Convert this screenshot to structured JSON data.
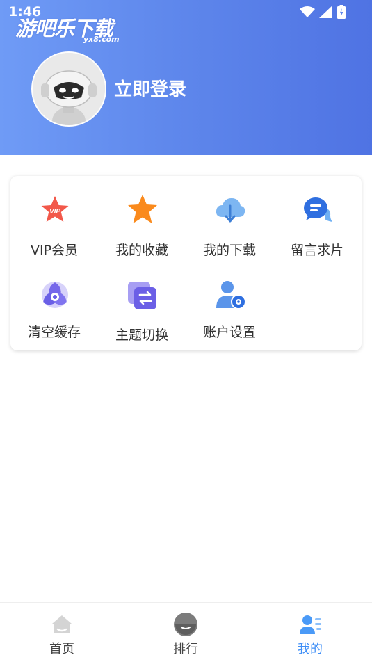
{
  "status_bar": {
    "time": "1:46"
  },
  "watermark": {
    "text": "游吧乐下载",
    "sub": "yx8.com"
  },
  "header": {
    "login_label": "立即登录"
  },
  "menu": {
    "items": [
      {
        "label": "VIP会员",
        "icon": "vip-star-icon"
      },
      {
        "label": "我的收藏",
        "icon": "star-icon"
      },
      {
        "label": "我的下载",
        "icon": "cloud-download-icon"
      },
      {
        "label": "留言求片",
        "icon": "message-icon"
      },
      {
        "label": "清空缓存",
        "icon": "clear-cache-icon"
      },
      {
        "label": "主题切换",
        "icon": "theme-switch-icon"
      },
      {
        "label": "账户设置",
        "icon": "account-settings-icon"
      }
    ]
  },
  "tabbar": {
    "tabs": [
      {
        "label": "首页",
        "icon": "home-icon"
      },
      {
        "label": "排行",
        "icon": "ranking-icon"
      },
      {
        "label": "我的",
        "icon": "profile-icon",
        "active": true
      }
    ]
  },
  "colors": {
    "header_start": "#6f9bf6",
    "header_end": "#4f73e3",
    "active_tab": "#3f8ff7"
  }
}
